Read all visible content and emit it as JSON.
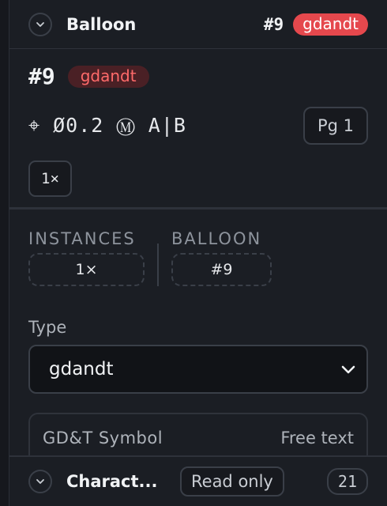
{
  "header": {
    "title": "Balloon",
    "number": "#9",
    "type_badge": "gdandt",
    "chevron_icon": "chevron-down-icon"
  },
  "summary": {
    "number": "#9",
    "type_badge": "gdandt",
    "feature_control_frame": "⌖ Ø0.2 Ⓜ A|B",
    "page_button": "Pg 1",
    "count_button": "1×"
  },
  "stats": {
    "instances_label": "INSTANCES",
    "instances_value": "1×",
    "balloon_label": "BALLOON",
    "balloon_value": "#9"
  },
  "type_field": {
    "label": "Type",
    "value": "gdandt",
    "dropdown_icon": "chevron-down-icon"
  },
  "gdt_card": {
    "title": "GD&T Symbol",
    "right_label": "Free text"
  },
  "footer": {
    "title": "Charact...",
    "badge": "Read only",
    "count": "21",
    "chevron_icon": "chevron-down-icon"
  },
  "colors": {
    "background": "#1b1e24",
    "accent_red": "#e5484d",
    "badge_dark_red_bg": "#4a2025",
    "badge_dark_red_text": "#ff6a6a"
  }
}
